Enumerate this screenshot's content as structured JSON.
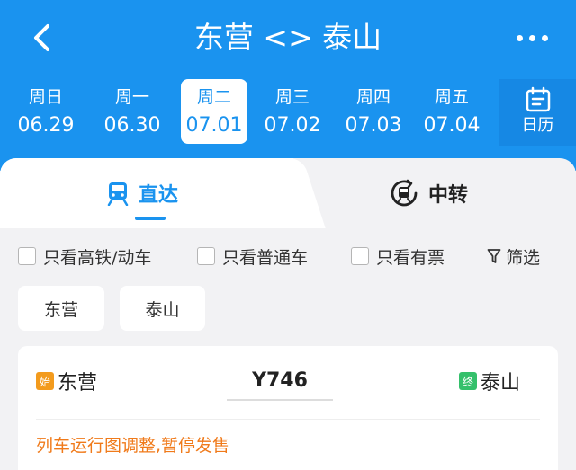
{
  "header": {
    "title": "东营 <> 泰山",
    "dates": [
      {
        "weekday": "周日",
        "date": "06.29"
      },
      {
        "weekday": "周一",
        "date": "06.30"
      },
      {
        "weekday": "周二",
        "date": "07.01"
      },
      {
        "weekday": "周三",
        "date": "07.02"
      },
      {
        "weekday": "周四",
        "date": "07.03"
      },
      {
        "weekday": "周五",
        "date": "07.04"
      }
    ],
    "selected_index": 2,
    "calendar_label": "日历",
    "icons": {
      "back": "back-arrow-icon",
      "more": "more-dots-icon",
      "calendar": "calendar-icon"
    }
  },
  "tabs": {
    "direct": "直达",
    "transfer": "中转",
    "icons": {
      "direct": "train-icon",
      "transfer": "transfer-train-icon"
    }
  },
  "filters": {
    "high_speed": "只看高铁/动车",
    "normal": "只看普通车",
    "has_ticket": "只看有票",
    "filter": "筛选",
    "filter_icon": "funnel-icon"
  },
  "stations": {
    "from": "东营",
    "to": "泰山"
  },
  "train": {
    "start_badge": "始",
    "from": "东营",
    "number": "Y746",
    "end_badge": "终",
    "to": "泰山",
    "notice": "列车运行图调整,暂停发售"
  },
  "colors": {
    "accent": "#1a93ef",
    "start_badge": "#f39b1d",
    "end_badge": "#34c06b",
    "notice": "#f07a1a"
  }
}
